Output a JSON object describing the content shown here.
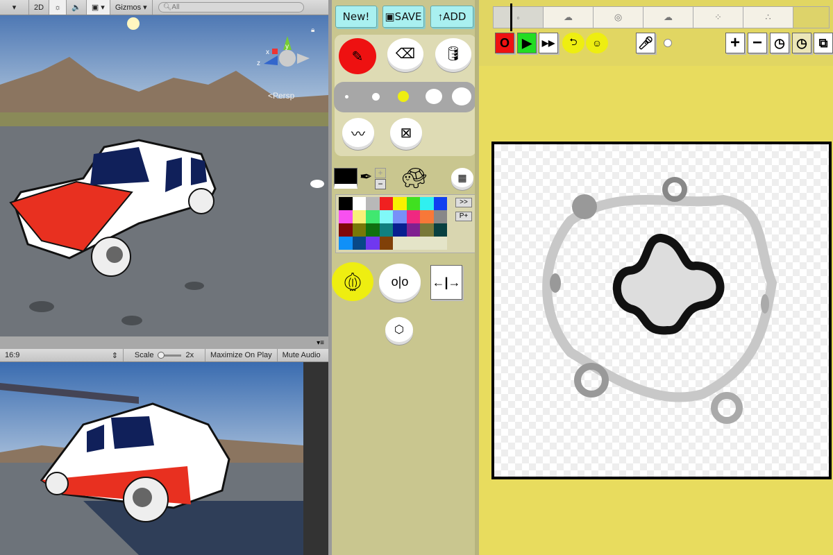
{
  "scene_toolbar": {
    "mode_2d": "2D",
    "gizmos": "Gizmos",
    "search_placeholder": "All",
    "persp": "<Persp",
    "axis_y": "y",
    "axis_x": "x",
    "axis_z": "z"
  },
  "game_toolbar": {
    "aspect": "16:9",
    "scale_label": "Scale",
    "scale_value": "2x",
    "maximize": "Maximize On Play",
    "mute": "Mute Audio"
  },
  "tools": {
    "new": "New!",
    "save": "SAVE",
    "add": "ADD",
    "paged_next": ">>",
    "palette_add": "P+",
    "plus": "+",
    "minus": "−"
  },
  "palette": [
    "#000000",
    "#ffffff",
    "#b8b8b8",
    "#f02020",
    "#f8f000",
    "#40e020",
    "#30f0f0",
    "#1040f0",
    "#f850f0",
    "#f8f078",
    "#40e870",
    "#80f8f8",
    "#7890f8",
    "#f02880",
    "#f87838",
    "#888888",
    "#800808",
    "#787808",
    "#107010",
    "#108080",
    "#082090",
    "#802090",
    "#787838",
    "#084040",
    "#1090f8",
    "#084888",
    "#7038f0",
    "#804008",
    "#e4e4c8",
    "#e4e4c8",
    "#e4e4c8",
    "#e4e4c8"
  ],
  "colors": {
    "current": "#000000",
    "accent_red": "#ee1111",
    "accent_yellow": "#eeee11",
    "panel": "#c9c68f",
    "workspace": "#e8dc5e"
  },
  "frames": [
    "frame-1",
    "frame-2",
    "frame-3",
    "frame-4",
    "frame-5",
    "frame-6"
  ]
}
